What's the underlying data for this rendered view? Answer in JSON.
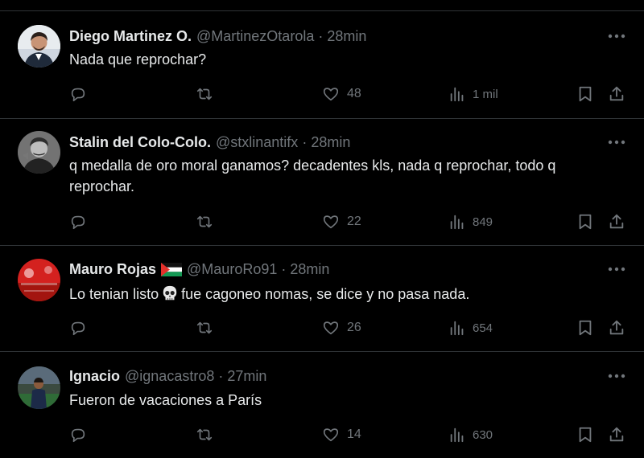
{
  "tweets": [
    {
      "name": "Diego Martinez O.",
      "handle": "@MartinezOtarola",
      "separator": "·",
      "time": "28min",
      "text": "Nada que reprochar?",
      "replies": "",
      "retweets": "",
      "likes": "48",
      "views": "1 mil"
    },
    {
      "name": "Stalin del Colo-Colo.",
      "handle": "@stxlinantifx",
      "separator": "·",
      "time": "28min",
      "text": "q medalla de oro moral ganamos? decadentes kls, nada q reprochar, todo q reprochar.",
      "replies": "",
      "retweets": "",
      "likes": "22",
      "views": "849"
    },
    {
      "name": "Mauro Rojas",
      "handle": "@MauroRo91",
      "separator": "·",
      "time": "28min",
      "text_before_emoji": "Lo tenian listo",
      "text_after_emoji": "fue cagoneo nomas, se dice y no pasa nada.",
      "replies": "",
      "retweets": "",
      "likes": "26",
      "views": "654"
    },
    {
      "name": "Ignacio",
      "handle": "@ignacastro8",
      "separator": "·",
      "time": "27min",
      "text": "Fueron de vacaciones a París",
      "replies": "",
      "retweets": "",
      "likes": "14",
      "views": "630"
    }
  ],
  "colors": {
    "background": "#000000",
    "primary_text": "#e7e9ea",
    "secondary_text": "#71767b",
    "divider": "#2f3336"
  },
  "icons": {
    "reply": "reply-icon",
    "retweet": "retweet-icon",
    "like": "heart-icon",
    "views": "views-chart-icon",
    "bookmark": "bookmark-icon",
    "share": "share-icon",
    "more": "more-dots-icon",
    "flag": "palestine-flag-icon",
    "emoji": "skull-emoji-icon"
  }
}
